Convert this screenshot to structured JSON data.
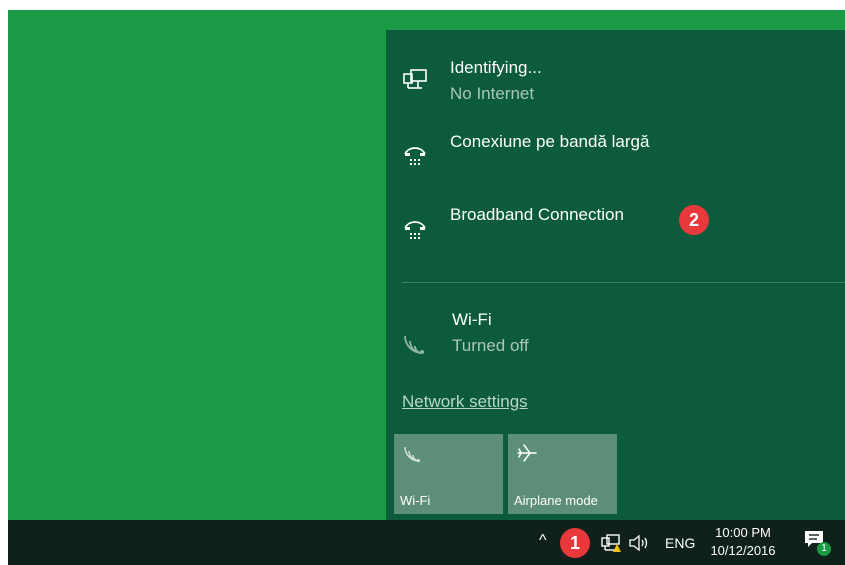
{
  "networks": [
    {
      "name": "Identifying...",
      "status": "No Internet",
      "icon": "wired-network-icon"
    },
    {
      "name": "Conexiune pe bandă largă",
      "status": "",
      "icon": "dialup-icon"
    },
    {
      "name": "Broadband Connection",
      "status": "",
      "icon": "dialup-icon"
    }
  ],
  "wifi": {
    "name": "Wi-Fi",
    "status": "Turned off",
    "icon": "wifi-icon"
  },
  "network_settings_label": "Network settings",
  "quick_actions": [
    {
      "label": "Wi-Fi",
      "icon": "wifi-icon"
    },
    {
      "label": "Airplane mode",
      "icon": "airplane-icon"
    }
  ],
  "taskbar": {
    "language": "ENG",
    "time": "10:00 PM",
    "date": "10/12/2016",
    "notification_count": "1"
  },
  "callouts": [
    "1",
    "2"
  ],
  "colors": {
    "desktop": "#1a9a45",
    "flyout": "#0b5b3c",
    "tile": "#5d8f78",
    "taskbar": "#10201b",
    "callout": "#e8383c"
  }
}
